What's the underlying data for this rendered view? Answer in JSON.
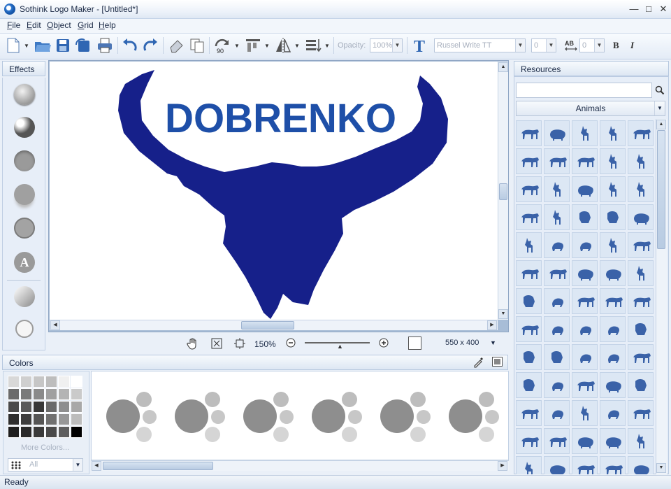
{
  "window": {
    "title": "Sothink Logo Maker - [Untitled*]",
    "minimize": "—",
    "restore": "□",
    "close": "✕"
  },
  "menu": {
    "items": [
      {
        "label": "File",
        "u": "F",
        "rest": "ile"
      },
      {
        "label": "Edit",
        "u": "E",
        "rest": "dit"
      },
      {
        "label": "Object",
        "u": "O",
        "rest": "bject"
      },
      {
        "label": "Grid",
        "u": "G",
        "rest": "rid"
      },
      {
        "label": "Help",
        "u": "H",
        "rest": "elp"
      }
    ]
  },
  "toolbar": {
    "rotate_label": "90",
    "opacity_label": "Opacity:",
    "opacity_value": "100%",
    "font_value": "Russel Write TT",
    "size_value": "0",
    "spacing_value": "0",
    "bold": "B",
    "italic": "I"
  },
  "effects": {
    "title": "Effects",
    "text_effect_letter": "A"
  },
  "canvas": {
    "logo_text": "DOBRENKO",
    "logo_color": "#16208a",
    "text_color": "#1e4fa8"
  },
  "zoom": {
    "level": "150%",
    "canvas_size": "550 x 400"
  },
  "colors": {
    "title": "Colors",
    "more_colors": "More Colors...",
    "filter_value": "All"
  },
  "resources": {
    "title": "Resources",
    "search_value": "",
    "category": "Animals",
    "icon_color": "#3a62a8",
    "items": [
      "bear",
      "boar",
      "kangaroo",
      "deer",
      "hedgehog",
      "cow",
      "cheetah",
      "bull",
      "deer",
      "antelope",
      "cheetah",
      "deer",
      "pig",
      "stag",
      "giraffe",
      "wolf",
      "kangaroo",
      "monkey",
      "lioness",
      "elephant",
      "kangaroo",
      "rabbit",
      "rat",
      "kangaroo",
      "camel",
      "horse",
      "horse",
      "pig",
      "pig",
      "kangaroo",
      "lion",
      "squirrel",
      "bull",
      "horse",
      "dog",
      "bull",
      "rat",
      "spider",
      "teddy-bear",
      "cat",
      "cat",
      "cat",
      "owl",
      "lizard",
      "dog",
      "monkey",
      "frog",
      "dog",
      "pig",
      "lion",
      "horse",
      "lizard",
      "deer",
      "spider",
      "camel",
      "dog",
      "horse",
      "elephant",
      "rhino",
      "kangaroo",
      "deer",
      "pig",
      "cow",
      "camel",
      "whale"
    ]
  },
  "status": {
    "text": "Ready"
  },
  "theme": {
    "accent": "#3a62a8",
    "panel": "#e7eef8"
  }
}
